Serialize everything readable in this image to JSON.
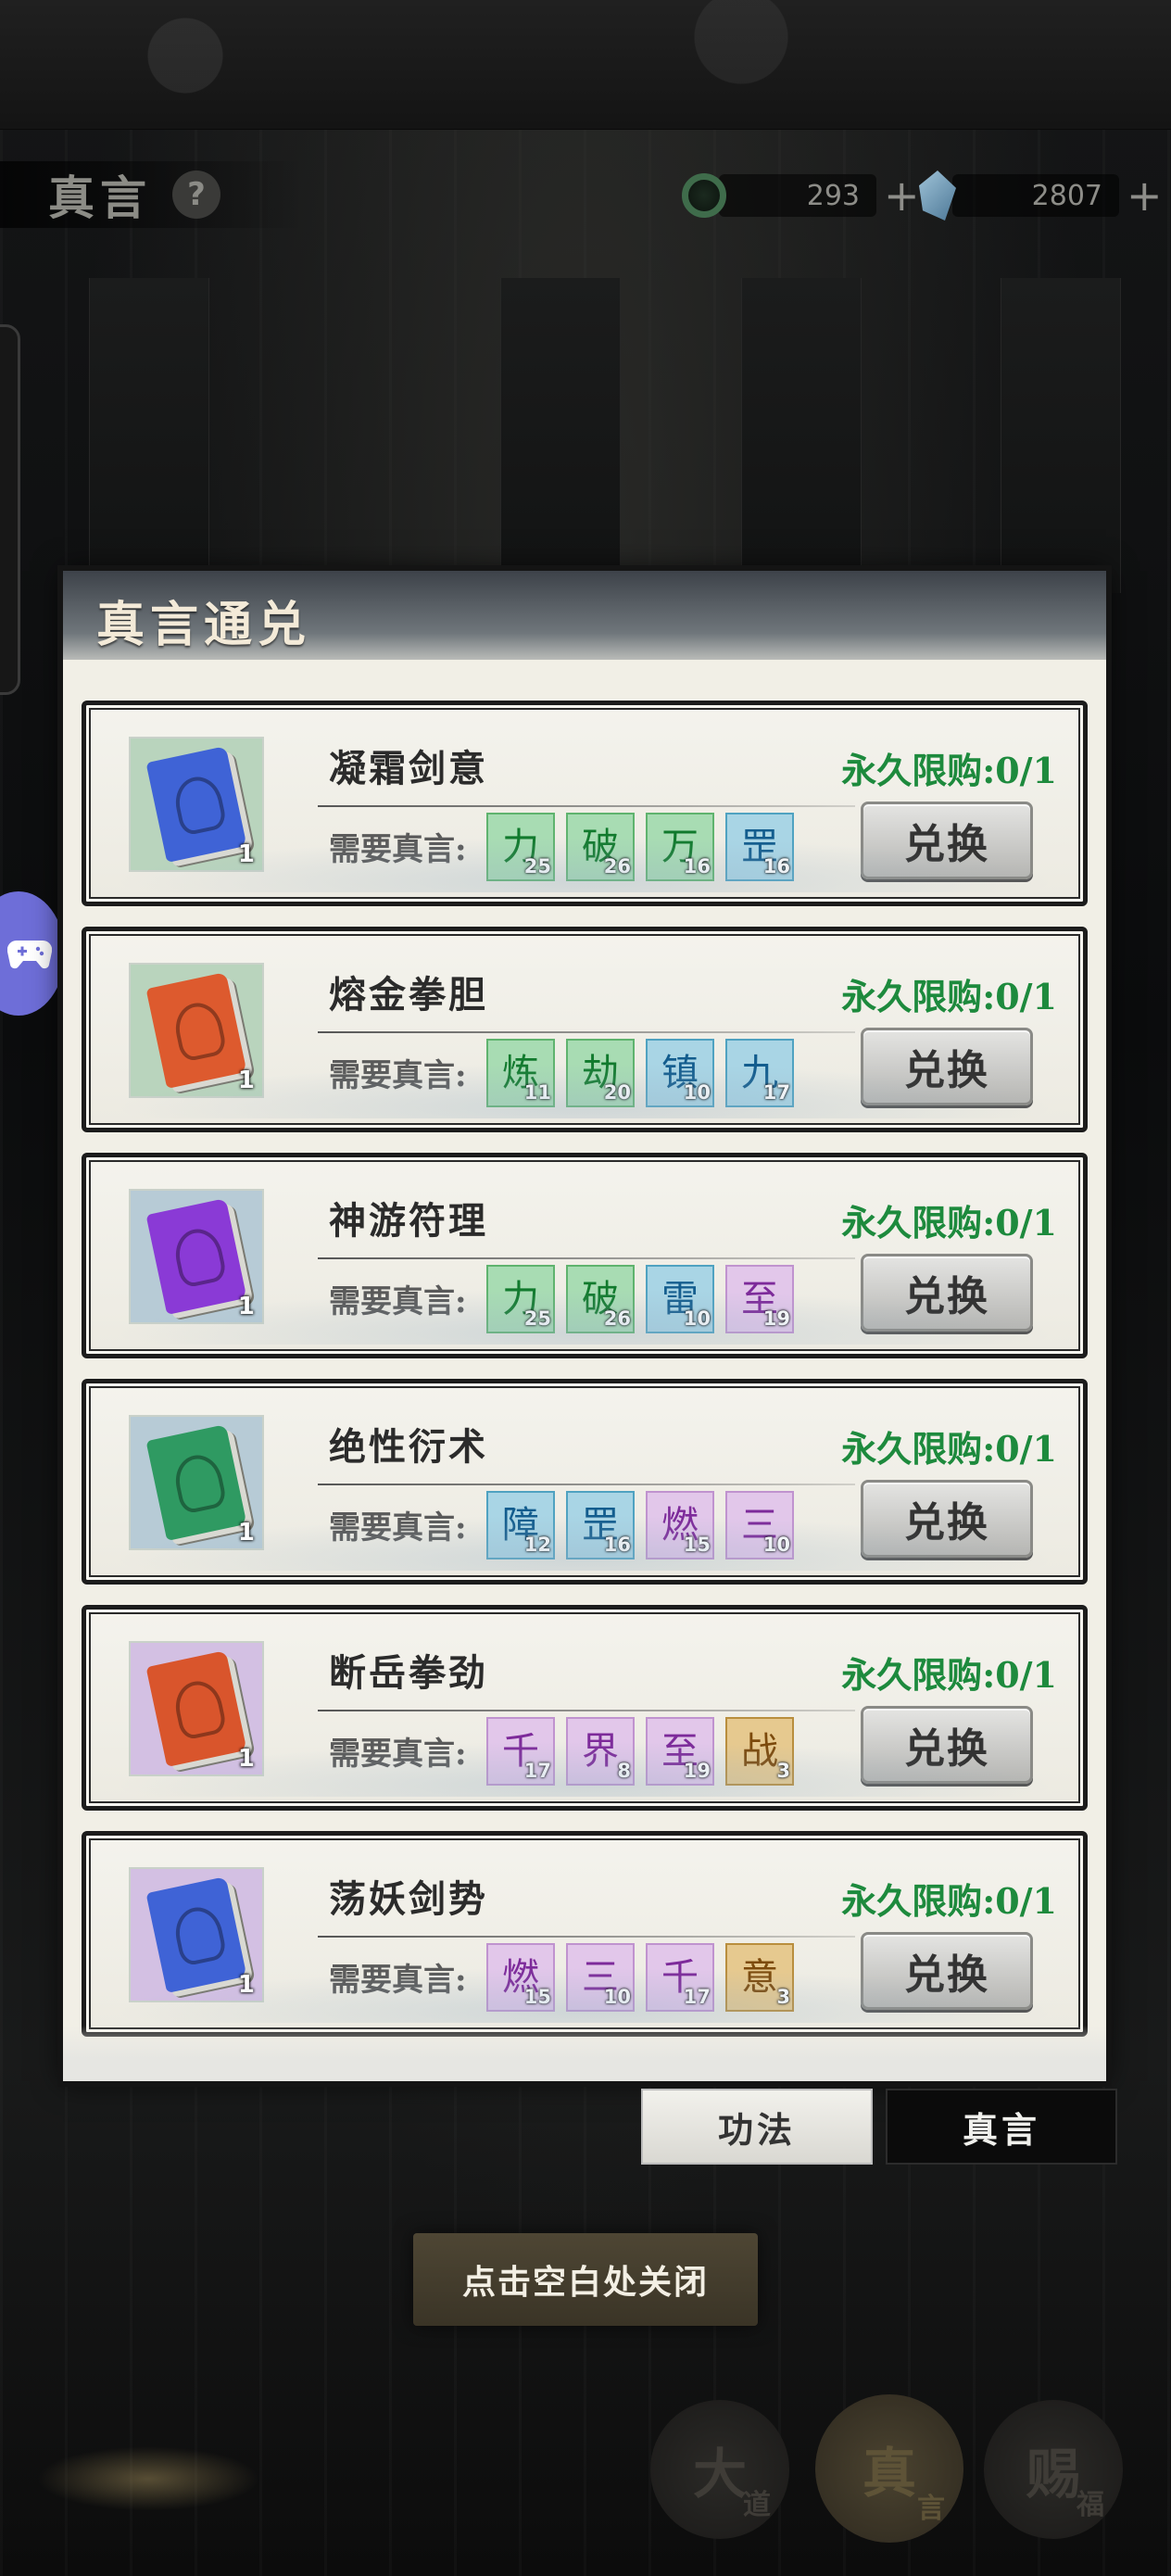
{
  "header": {
    "title": "真言",
    "help_symbol": "?",
    "currency_jade": {
      "value": "293",
      "plus": "+",
      "icon": "jade-ring-icon"
    },
    "currency_crystal": {
      "value": "2807",
      "plus": "+",
      "icon": "crystal-icon"
    }
  },
  "modal": {
    "title": "真言通兑",
    "items": [
      {
        "name": "凝霜剑意",
        "book_color": "#3f63d6",
        "icon_bg": "#b9d4bd",
        "quantity": "1",
        "req_label": "需要真言:",
        "runes": [
          {
            "glyph": "力",
            "count": "25",
            "tier": "green"
          },
          {
            "glyph": "破",
            "count": "26",
            "tier": "green"
          },
          {
            "glyph": "万",
            "count": "16",
            "tier": "green"
          },
          {
            "glyph": "罡",
            "count": "16",
            "tier": "blue"
          }
        ],
        "limit": "永久限购:0/1",
        "button": "兑换"
      },
      {
        "name": "熔金拳胆",
        "book_color": "#dd5a2e",
        "icon_bg": "#b9d4bd",
        "quantity": "1",
        "req_label": "需要真言:",
        "runes": [
          {
            "glyph": "炼",
            "count": "11",
            "tier": "green"
          },
          {
            "glyph": "劫",
            "count": "20",
            "tier": "green"
          },
          {
            "glyph": "镇",
            "count": "10",
            "tier": "blue"
          },
          {
            "glyph": "九",
            "count": "17",
            "tier": "blue"
          }
        ],
        "limit": "永久限购:0/1",
        "button": "兑换"
      },
      {
        "name": "神游符理",
        "book_color": "#8a3ad6",
        "icon_bg": "#b7cbd6",
        "quantity": "1",
        "req_label": "需要真言:",
        "runes": [
          {
            "glyph": "力",
            "count": "25",
            "tier": "green"
          },
          {
            "glyph": "破",
            "count": "26",
            "tier": "green"
          },
          {
            "glyph": "雷",
            "count": "10",
            "tier": "blue"
          },
          {
            "glyph": "至",
            "count": "19",
            "tier": "purple"
          }
        ],
        "limit": "永久限购:0/1",
        "button": "兑换"
      },
      {
        "name": "绝性衍术",
        "book_color": "#2f9a62",
        "icon_bg": "#b7cbd6",
        "quantity": "1",
        "req_label": "需要真言:",
        "runes": [
          {
            "glyph": "障",
            "count": "12",
            "tier": "blue"
          },
          {
            "glyph": "罡",
            "count": "16",
            "tier": "blue"
          },
          {
            "glyph": "燃",
            "count": "15",
            "tier": "purple"
          },
          {
            "glyph": "三",
            "count": "10",
            "tier": "purple"
          }
        ],
        "limit": "永久限购:0/1",
        "button": "兑换"
      },
      {
        "name": "断岳拳劲",
        "book_color": "#d9552c",
        "icon_bg": "#d3c0e3",
        "quantity": "1",
        "req_label": "需要真言:",
        "runes": [
          {
            "glyph": "千",
            "count": "17",
            "tier": "purple"
          },
          {
            "glyph": "界",
            "count": "8",
            "tier": "purple"
          },
          {
            "glyph": "至",
            "count": "19",
            "tier": "purple"
          },
          {
            "glyph": "战",
            "count": "3",
            "tier": "gold"
          }
        ],
        "limit": "永久限购:0/1",
        "button": "兑换"
      },
      {
        "name": "荡妖剑势",
        "book_color": "#3f63d6",
        "icon_bg": "#d3c0e3",
        "quantity": "1",
        "req_label": "需要真言:",
        "runes": [
          {
            "glyph": "燃",
            "count": "15",
            "tier": "purple"
          },
          {
            "glyph": "三",
            "count": "10",
            "tier": "purple"
          },
          {
            "glyph": "千",
            "count": "17",
            "tier": "purple"
          },
          {
            "glyph": "意",
            "count": "3",
            "tier": "gold"
          }
        ],
        "limit": "永久限购:0/1",
        "button": "兑换"
      }
    ]
  },
  "tabs": {
    "gongfa": "功法",
    "zhenyan": "真言"
  },
  "close_hint": "点击空白处关闭",
  "bottom_nav": {
    "dadao": {
      "main": "大",
      "sub": "道"
    },
    "zhenyan": {
      "main": "真",
      "sub": "言"
    },
    "cifu": {
      "main": "赐",
      "sub": "福"
    }
  }
}
